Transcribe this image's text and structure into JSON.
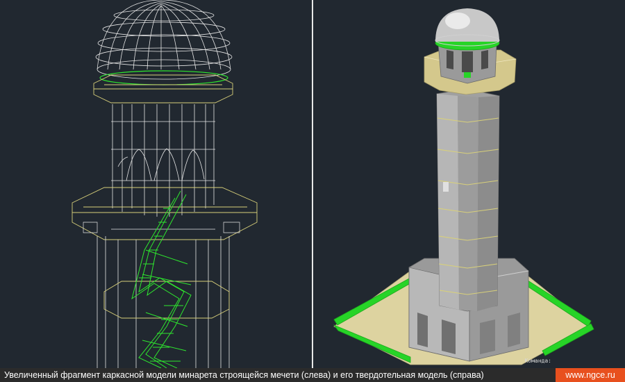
{
  "caption": {
    "text": "Увеличенный фрагмент каркасной модели минарета строящейся мечети (слева) и его твердотельная модель (справа)",
    "site": "www.ngce.ru"
  },
  "right_viewport": {
    "command_label": "Команда:"
  },
  "colors": {
    "background": "#212830",
    "wire_white": "#e6e6e6",
    "wire_yellow": "#d8d07a",
    "wire_green": "#2ee82e",
    "solid_gray": "#a8a8a8",
    "solid_tan": "#ddd3a0",
    "caption_accent": "#e8501e"
  }
}
